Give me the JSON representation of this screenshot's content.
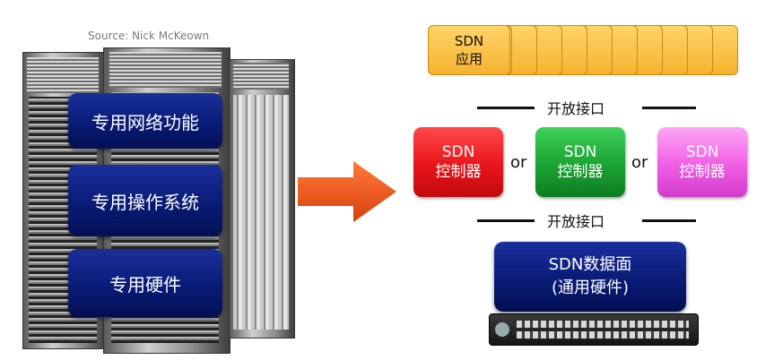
{
  "source": "Source: Nick McKeown",
  "left_stack": [
    {
      "label": "专用网络功能"
    },
    {
      "label": "专用操作系统"
    },
    {
      "label": "专用硬件"
    }
  ],
  "apps": {
    "front_line1": "SDN",
    "front_line2": "应用",
    "count": 11
  },
  "interface_top": "开放接口",
  "interface_bottom": "开放接口",
  "controllers": [
    {
      "line1": "SDN",
      "line2": "控制器",
      "color": "#e8151b"
    },
    {
      "line1": "SDN",
      "line2": "控制器",
      "color": "#1aa332"
    },
    {
      "line1": "SDN",
      "line2": "控制器",
      "color": "#f05ee6"
    }
  ],
  "or_label": "or",
  "data_plane": {
    "line1": "SDN数据面",
    "line2": "(通用硬件)"
  },
  "colors": {
    "arrow": "#ee5418",
    "blue_box": "#0c1f80"
  }
}
